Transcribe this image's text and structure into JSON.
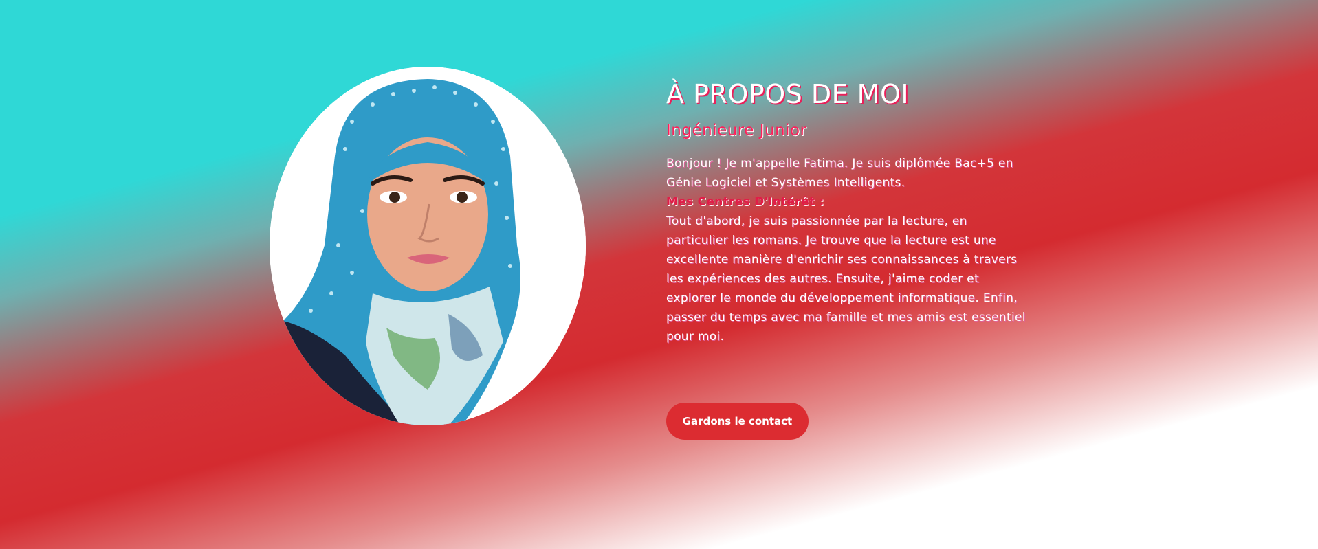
{
  "about": {
    "title": "À PROPOS DE MOI",
    "subtitle": "Ingénieure Junior",
    "intro": "Bonjour ! Je m'appelle Fatima. Je suis diplômée Bac+5 en Génie Logiciel et Systèmes Intelligents.",
    "interests_heading": "Mes Centres D'Intérêt :",
    "interests_text": "Tout d'abord, je suis passionnée par la lecture, en particulier les romans. Je trouve que la lecture est une excellente manière d'enrichir ses connaissances à travers les expériences des autres. Ensuite, j'aime coder et explorer le monde du développement informatique. Enfin, passer du temps avec ma famille et mes amis est essentiel pour moi."
  },
  "contact_button": {
    "label": "Gardons le contact"
  },
  "colors": {
    "teal": "#2fd8d6",
    "red": "#d42b30",
    "pink_accent": "#ff1f5a",
    "white": "#ffffff"
  },
  "portrait": {
    "icon": "profile-photo"
  }
}
